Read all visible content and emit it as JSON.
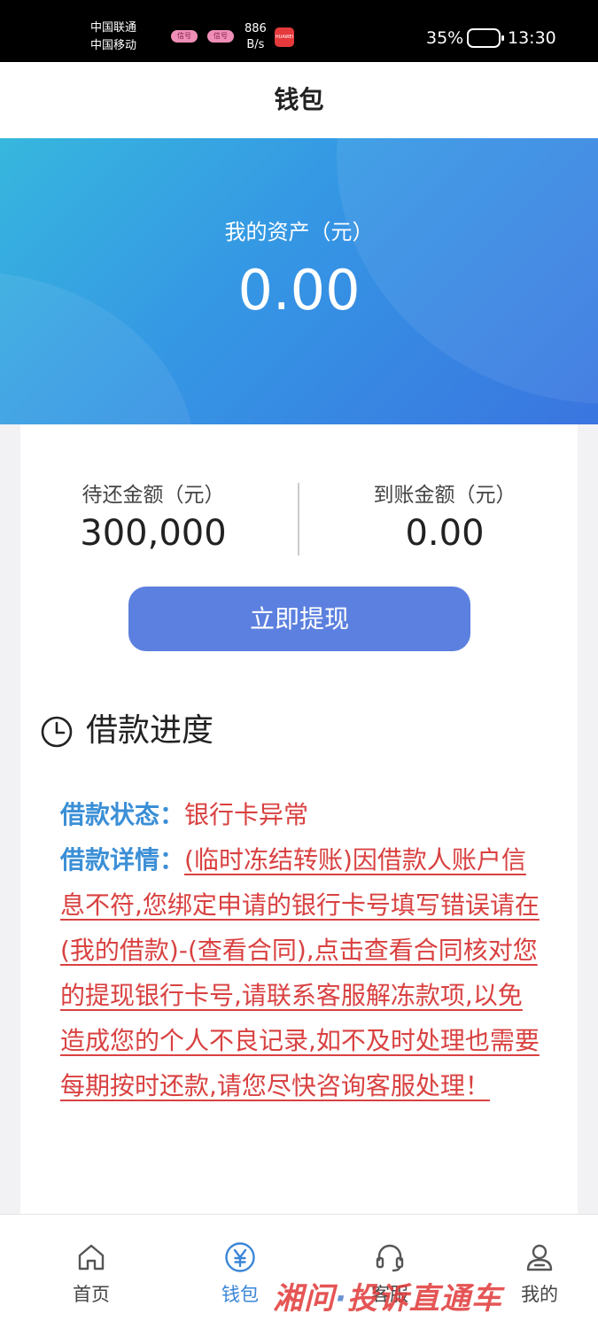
{
  "status_bar": {
    "carrier_1": "中国联通",
    "carrier_2": "中国移动",
    "signal_badge_1": "信号",
    "signal_badge_2": "信号",
    "net_speed_value": "886",
    "net_speed_unit": "B/s",
    "app_badge": "HUAWEI",
    "battery_percent": "35%",
    "time": "13:30"
  },
  "header": {
    "title": "钱包"
  },
  "assets": {
    "label": "我的资产（元）",
    "value": "0.00"
  },
  "balances": {
    "pending_label": "待还金额（元）",
    "pending_value": "300,000",
    "received_label": "到账金额（元）",
    "received_value": "0.00"
  },
  "withdraw_button": "立即提现",
  "loan_progress": {
    "title": "借款进度",
    "status_label": "借款状态：",
    "status_value": "银行卡异常",
    "detail_label": "借款详情：",
    "detail_value": "(临时冻结转账)因借款人账户信息不符,您绑定申请的银行卡号填写错误请在(我的借款)-(查看合同),点击查看合同核对您的提现银行卡号,请联系客服解冻款项,以免造成您的个人不良记录,如不及时处理也需要每期按时还款,请您尽快咨询客服处理！"
  },
  "bottom_nav": {
    "items": [
      {
        "label": "首页",
        "icon": "home-icon"
      },
      {
        "label": "钱包",
        "icon": "yuan-icon",
        "active": true
      },
      {
        "label": "客服",
        "icon": "headset-icon"
      },
      {
        "label": "我的",
        "icon": "user-icon"
      }
    ]
  },
  "watermark": {
    "text_left": "湘问",
    "separator": "·",
    "text_right": "投诉直通车"
  },
  "colors": {
    "accent_blue": "#3a86d8",
    "button_blue": "#5c80df",
    "label_blue": "#3b8fd6",
    "alert_red": "#d94141",
    "hero_start": "#37b7de",
    "hero_end": "#3a75e0"
  }
}
